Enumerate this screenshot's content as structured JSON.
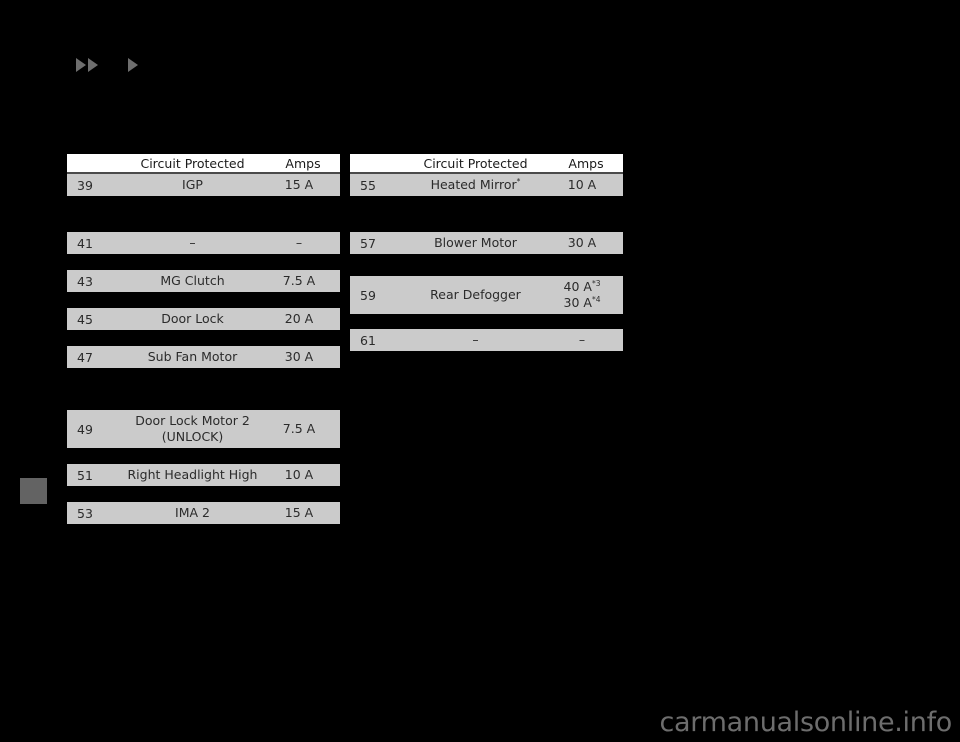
{
  "page": {
    "background_color": "#000000",
    "watermark": "carmanualsonline.info"
  },
  "nav": {
    "arrow_1": "arrow-right-icon",
    "arrow_2": "arrow-right-icon",
    "arrow_3": "arrow-right-icon"
  },
  "chapter_tab": {
    "label": "",
    "color": "#636363"
  },
  "tables": [
    {
      "id": "fuse-table-left",
      "headers": {
        "number": "",
        "circuit": "Circuit Protected",
        "amps": "Amps"
      },
      "rows": [
        {
          "number": "39",
          "circuit": "IGP",
          "circuit_sub": "",
          "amps": "15 A",
          "amps_sub": ""
        },
        {
          "number": "41",
          "circuit": "–",
          "circuit_sub": "",
          "amps": "–",
          "amps_sub": ""
        },
        {
          "number": "43",
          "circuit": "MG Clutch",
          "circuit_sub": "",
          "amps": "7.5 A",
          "amps_sub": ""
        },
        {
          "number": "45",
          "circuit": "Door Lock",
          "circuit_sub": "",
          "amps": "20 A",
          "amps_sub": ""
        },
        {
          "number": "47",
          "circuit": "Sub Fan Motor",
          "circuit_sub": "",
          "amps": "30 A",
          "amps_sub": ""
        },
        {
          "number": "49",
          "circuit": "Door Lock Motor 2",
          "circuit_sub": "(UNLOCK)",
          "amps": "7.5 A",
          "amps_sub": ""
        },
        {
          "number": "51",
          "circuit": "Right Headlight High",
          "circuit_sub": "",
          "amps": "10 A",
          "amps_sub": ""
        },
        {
          "number": "53",
          "circuit": "IMA 2",
          "circuit_sub": "",
          "amps": "15 A",
          "amps_sub": ""
        }
      ]
    },
    {
      "id": "fuse-table-right",
      "headers": {
        "number": "",
        "circuit": "Circuit Protected",
        "amps": "Amps"
      },
      "rows": [
        {
          "number": "55",
          "circuit": "Heated Mirror",
          "circuit_note": "*",
          "circuit_sub": "",
          "amps": "10 A",
          "amps_note": "",
          "amps_sub": ""
        },
        {
          "number": "57",
          "circuit": "Blower Motor",
          "circuit_note": "",
          "circuit_sub": "",
          "amps": "30 A",
          "amps_note": "",
          "amps_sub": ""
        },
        {
          "number": "59",
          "circuit": "Rear Defogger",
          "circuit_note": "",
          "circuit_sub": "",
          "amps": "40 A",
          "amps_note": "*3",
          "amps_sub": "30 A",
          "amps_sub_note": "*4"
        },
        {
          "number": "61",
          "circuit": "–",
          "circuit_note": "",
          "circuit_sub": "",
          "amps": "–",
          "amps_note": "",
          "amps_sub": ""
        }
      ]
    }
  ]
}
